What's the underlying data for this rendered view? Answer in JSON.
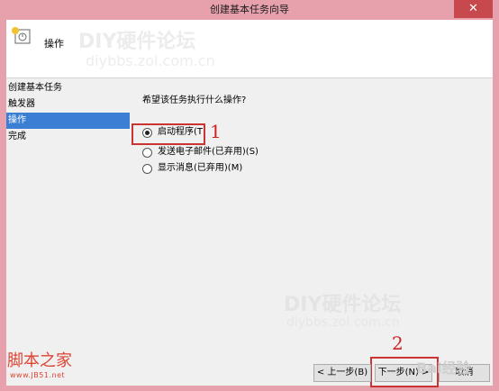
{
  "window": {
    "title": "创建基本任务向导",
    "close_label": "✕"
  },
  "header": {
    "title": "操作",
    "watermark_top": "DIY硬件论坛",
    "watermark_bottom": "diybbs.zol.com.cn"
  },
  "nav": {
    "items": [
      {
        "label": "创建基本任务"
      },
      {
        "label": "触发器"
      },
      {
        "label": "操作",
        "selected": true
      },
      {
        "label": "完成"
      }
    ]
  },
  "content": {
    "question": "希望该任务执行什么操作?",
    "options": [
      {
        "label": "启动程序(T)",
        "checked": true
      },
      {
        "label": "发送电子邮件(已弃用)(S)",
        "checked": false
      },
      {
        "label": "显示消息(已弃用)(M)",
        "checked": false
      }
    ],
    "step_one": "1",
    "step_two": "2",
    "watermark": "DIY硬件论坛"
  },
  "buttons": {
    "back": "< 上一步(B)",
    "next": "下一步(N) >",
    "cancel": "取消"
  },
  "branding": {
    "logo": "脚本之家",
    "logo_sub": "www.JB51.net",
    "baidu": "Bai经验"
  },
  "colors": {
    "accent": "#3b7fd4",
    "annotation": "#cc3333",
    "titlebar": "#e7a1ad"
  }
}
